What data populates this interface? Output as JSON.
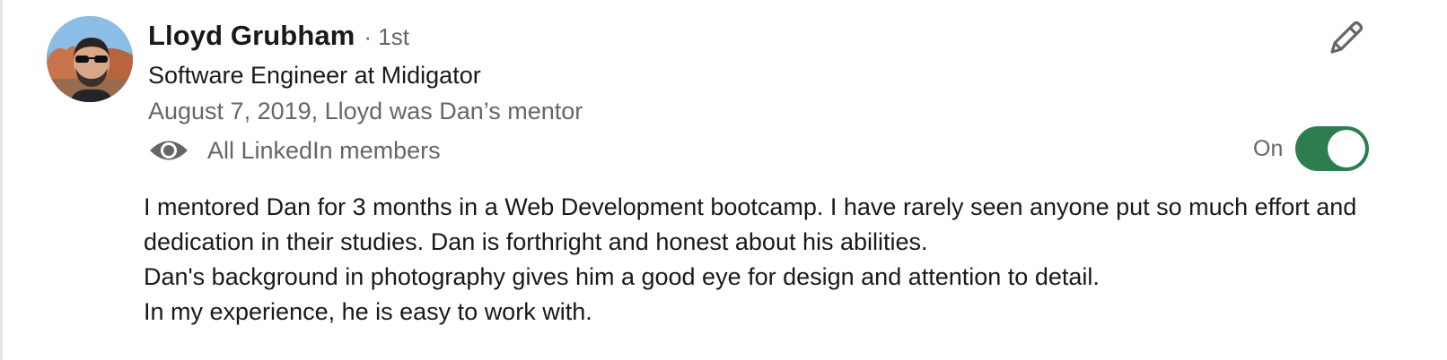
{
  "recommendation": {
    "author": {
      "name": "Lloyd Grubham",
      "degree": "· 1st",
      "headline": "Software Engineer at Midigator",
      "avatar_alt": "Lloyd Grubham profile photo"
    },
    "date_relation": "August 7, 2019, Lloyd was Dan’s mentor",
    "visibility": {
      "icon": "eye-icon",
      "label": "All LinkedIn members"
    },
    "toggle": {
      "label": "On",
      "state": "on",
      "color": "#2e7d4f"
    },
    "edit": {
      "icon": "pencil-icon"
    },
    "text_lines": [
      "I mentored Dan for 3 months in a Web Development bootcamp. I have rarely seen anyone put so much effort and dedication in their studies. Dan is forthright and honest about his abilities.",
      "Dan's background in photography gives him a good eye for design and attention to detail.",
      "In my experience, he is easy to work with."
    ]
  }
}
